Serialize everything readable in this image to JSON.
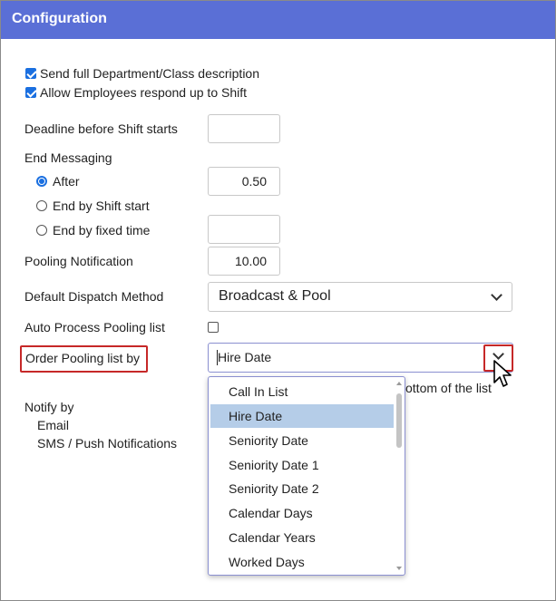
{
  "header": {
    "title": "Configuration"
  },
  "options": {
    "send_full_description": {
      "label": "Send full Department/Class description",
      "checked": true
    },
    "allow_respond_up": {
      "label": "Allow Employees respond up to Shift",
      "checked": true
    }
  },
  "deadline": {
    "label": "Deadline before Shift starts",
    "value": ""
  },
  "end_messaging": {
    "label": "End Messaging",
    "after": {
      "label": "After",
      "value": "0.50",
      "selected": true
    },
    "by_shift_start": {
      "label": "End by Shift start"
    },
    "by_fixed_time": {
      "label": "End by fixed time",
      "value": ""
    }
  },
  "pooling_notification": {
    "label": "Pooling Notification",
    "value": "10.00"
  },
  "dispatch": {
    "label": "Default Dispatch Method",
    "value": "Broadcast & Pool"
  },
  "auto_process": {
    "label": "Auto Process Pooling list",
    "checked": false
  },
  "order_pooling": {
    "label": "Order Pooling list by",
    "value": "Hire Date",
    "behind_text": "ottom of the list",
    "options": [
      "Call In List",
      "Hire Date",
      "Seniority Date",
      "Seniority Date 1",
      "Seniority Date 2",
      "Calendar Days",
      "Calendar Years",
      "Worked Days"
    ],
    "selected": "Hire Date"
  },
  "notify": {
    "label": "Notify by",
    "email": "Email",
    "sms": "SMS / Push Notifications"
  },
  "colors": {
    "header": "#5a6fd6",
    "accent": "#1a6fe0",
    "highlight": "#b5cde8",
    "callout": "#c62828"
  }
}
